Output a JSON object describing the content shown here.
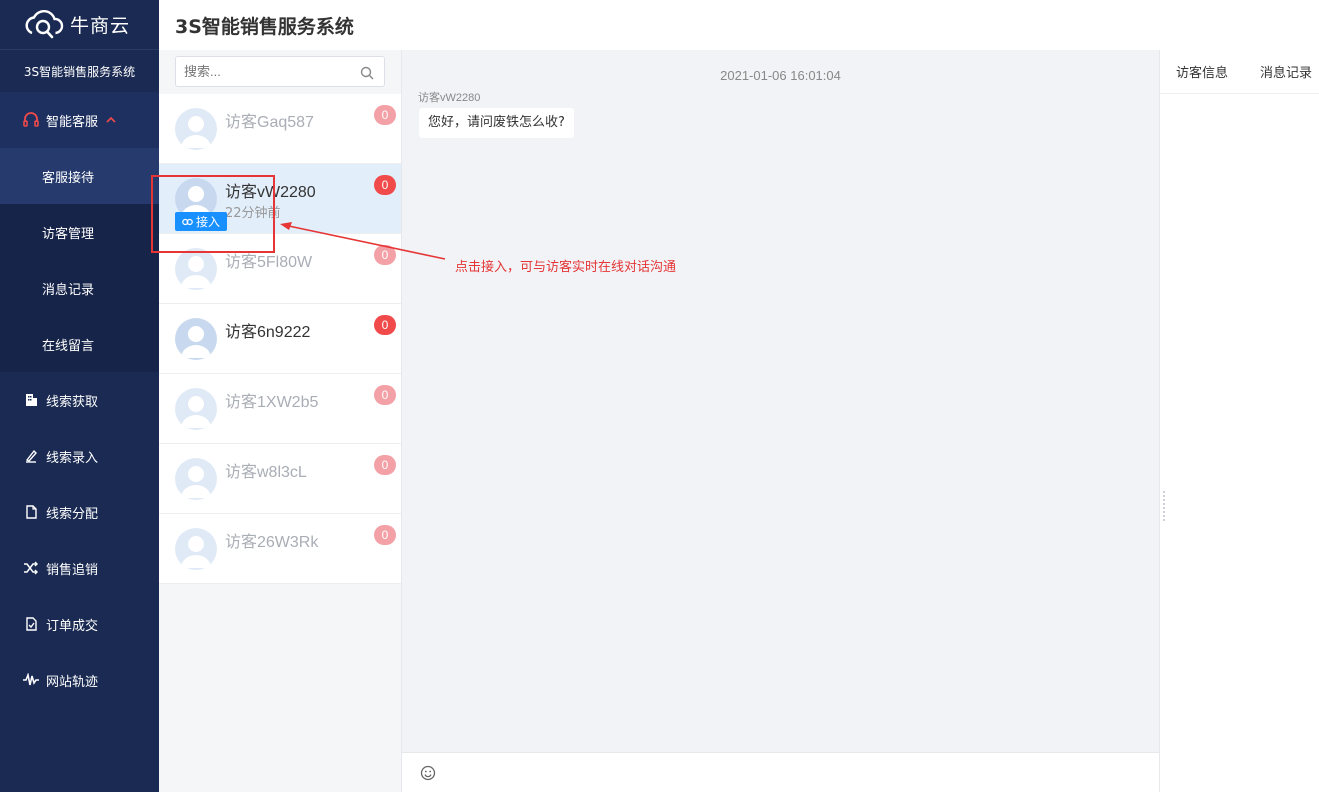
{
  "app": {
    "logo_text": "牛商云",
    "system_name": "3S智能销售服务系统",
    "header_title": "3S智能销售服务系统"
  },
  "sidebar": {
    "parent": {
      "label": "智能客服",
      "icon": "headset-icon",
      "color": "#f04a4a"
    },
    "subs": [
      {
        "label": "客服接待"
      },
      {
        "label": "访客管理"
      },
      {
        "label": "消息记录"
      },
      {
        "label": "在线留言"
      }
    ],
    "items": [
      {
        "label": "线索获取",
        "icon": "building-icon"
      },
      {
        "label": "线索录入",
        "icon": "pen-icon"
      },
      {
        "label": "线索分配",
        "icon": "document-icon"
      },
      {
        "label": "销售追销",
        "icon": "shuffle-icon"
      },
      {
        "label": "订单成交",
        "icon": "check-doc-icon"
      },
      {
        "label": "网站轨迹",
        "icon": "wave-icon"
      }
    ]
  },
  "search": {
    "placeholder": "搜索..."
  },
  "visitors": [
    {
      "name": "访客Gaq587",
      "count": "0"
    },
    {
      "name": "访客vW2280",
      "count": "0",
      "time": "22分钟前",
      "join_label": "接入"
    },
    {
      "name": "访客5Fl80W",
      "count": "0"
    },
    {
      "name": "访客6n9222",
      "count": "0"
    },
    {
      "name": "访客1XW2b5",
      "count": "0"
    },
    {
      "name": "访客w8l3cL",
      "count": "0"
    },
    {
      "name": "访客26W3Rk",
      "count": "0"
    }
  ],
  "chat": {
    "timestamp": "2021-01-06 16:01:04",
    "sender": "访客vW2280",
    "message": "您好，请问废铁怎么收?"
  },
  "info_tabs": [
    "访客信息",
    "消息记录"
  ],
  "annotation": {
    "text": "点击接入，可与访客实时在线对话沟通",
    "color": "#e53535"
  },
  "colors": {
    "sidebar_bg": "#1a2a52",
    "accent": "#1890ff",
    "badge": "#f04a4a"
  }
}
